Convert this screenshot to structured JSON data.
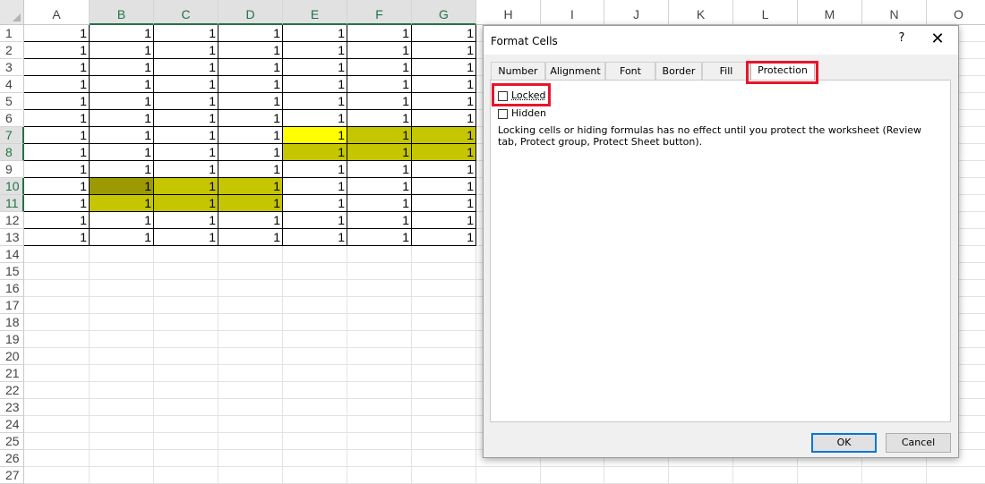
{
  "sheet": {
    "columns": [
      "A",
      "B",
      "C",
      "D",
      "E",
      "F",
      "G",
      "H",
      "I",
      "J",
      "K",
      "L",
      "M",
      "N",
      "O"
    ],
    "rows": [
      "1",
      "2",
      "3",
      "4",
      "5",
      "6",
      "7",
      "8",
      "9",
      "10",
      "11",
      "12",
      "13",
      "14",
      "15",
      "16",
      "17",
      "18",
      "19",
      "20",
      "21",
      "22",
      "23",
      "24",
      "25",
      "26",
      "27"
    ],
    "cell_value": "1",
    "highlight_colors": {
      "yellow": "#ffff00",
      "olive": "#c5c500",
      "dark_olive": "#9c9a00"
    },
    "header_accent": "#217346"
  },
  "dialog": {
    "title": "Format Cells",
    "help": "?",
    "close": "✕",
    "tabs": [
      "Number",
      "Alignment",
      "Font",
      "Border",
      "Fill",
      "Protection"
    ],
    "active_tab": "Protection",
    "locked_label": "Locked",
    "hidden_label": "Hidden",
    "locked_checked": false,
    "hidden_checked": false,
    "note": "Locking cells or hiding formulas has no effect until you protect the worksheet (Review tab, Protect group, Protect Sheet button).",
    "ok_label": "OK",
    "cancel_label": "Cancel",
    "annotation_color": "#e8152b"
  }
}
